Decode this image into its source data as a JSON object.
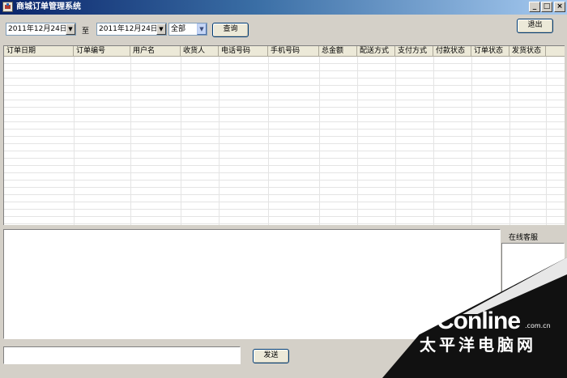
{
  "window": {
    "title": "商城订单管理系统",
    "min": "_",
    "max": "□",
    "close": "×"
  },
  "toolbar": {
    "date_from": "2011年12月24日",
    "to_label": "至",
    "date_to": "2011年12月24日",
    "status_filter": "全部",
    "query_label": "查询",
    "exit_label": "退出"
  },
  "orders_table": {
    "columns": [
      "订单日期",
      "订单编号",
      "用户名",
      "收货人",
      "电话号码",
      "手机号码",
      "总金额",
      "配送方式",
      "支付方式",
      "付款状态",
      "订单状态",
      "发货状态"
    ],
    "rows": []
  },
  "chat": {
    "online_service_label": "在线客服",
    "message_input": "",
    "send_label": "发送"
  },
  "watermark": {
    "logo": "PConline",
    "domain": ".com.cn",
    "chinese": "太平洋电脑网"
  }
}
